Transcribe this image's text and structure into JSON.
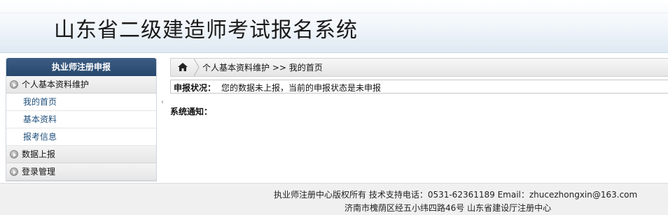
{
  "header": {
    "title": "山东省二级建造师考试报名系统"
  },
  "sidebar": {
    "header": "执业师注册申报",
    "groups": [
      {
        "label": "个人基本资料维护",
        "items": [
          "我的首页",
          "基本资料",
          "报考信息"
        ]
      },
      {
        "label": "数据上报"
      },
      {
        "label": "登录管理"
      }
    ]
  },
  "breadcrumb": {
    "text": "个人基本资料维护 >> 我的首页"
  },
  "status": {
    "label": "申报状况：",
    "text": "您的数据未上报，当前的申报状态是未申报"
  },
  "notice": {
    "label": "系统通知："
  },
  "footer": {
    "line1": "执业师注册中心版权所有 技术支持电话：0531-62361189 Email：zhucezhongxin@163.com",
    "line2": "济南市槐荫区经五小纬四路46号 山东省建设厅注册中心"
  }
}
